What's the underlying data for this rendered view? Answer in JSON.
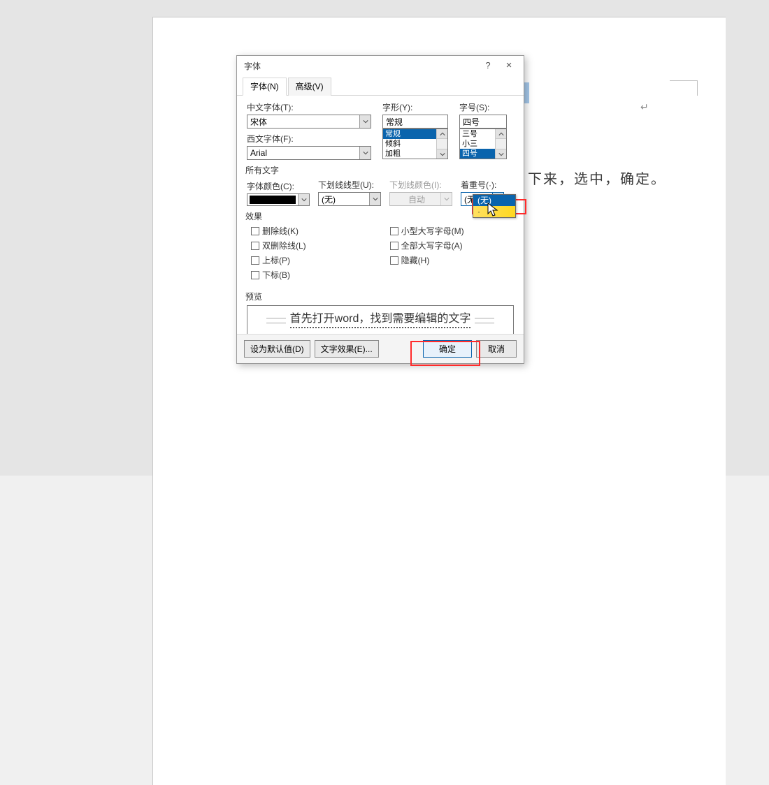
{
  "document": {
    "visible_text": "下来，选中，确定。",
    "end_mark": "↵"
  },
  "dialog": {
    "title": "字体",
    "help": "?",
    "close": "×",
    "tabs": {
      "font": "字体(N)",
      "advanced": "高级(V)"
    },
    "labels": {
      "chinese_font": "中文字体(T):",
      "western_font": "西文字体(F):",
      "style": "字形(Y):",
      "size": "字号(S):",
      "all_text": "所有文字",
      "font_color": "字体颜色(C):",
      "underline_style": "下划线线型(U):",
      "underline_color": "下划线颜色(I):",
      "emphasis": "着重号(·):",
      "effects": "效果",
      "preview": "预览"
    },
    "values": {
      "chinese_font": "宋体",
      "western_font": "Arial",
      "style_input": "常规",
      "size_input": "四号",
      "underline_style": "(无)",
      "underline_color": "自动",
      "emphasis": "(无)"
    },
    "style_list": {
      "opt1": "常规",
      "opt2": "倾斜",
      "opt3": "加粗"
    },
    "size_list": {
      "opt1": "三号",
      "opt2": "小三",
      "opt3": "四号"
    },
    "emphasis_list": {
      "opt1": "(无)",
      "opt2": "·"
    },
    "effects_left": {
      "strike": "删除线(K)",
      "dstrike": "双删除线(L)",
      "super": "上标(P)",
      "sub": "下标(B)"
    },
    "effects_right": {
      "smallcaps": "小型大写字母(M)",
      "allcaps": "全部大写字母(A)",
      "hidden": "隐藏(H)"
    },
    "preview_text": "首先打开word，找到需要编辑的文字",
    "buttons": {
      "set_default": "设为默认值(D)",
      "text_effects": "文字效果(E)...",
      "ok": "确定",
      "cancel": "取消"
    }
  }
}
